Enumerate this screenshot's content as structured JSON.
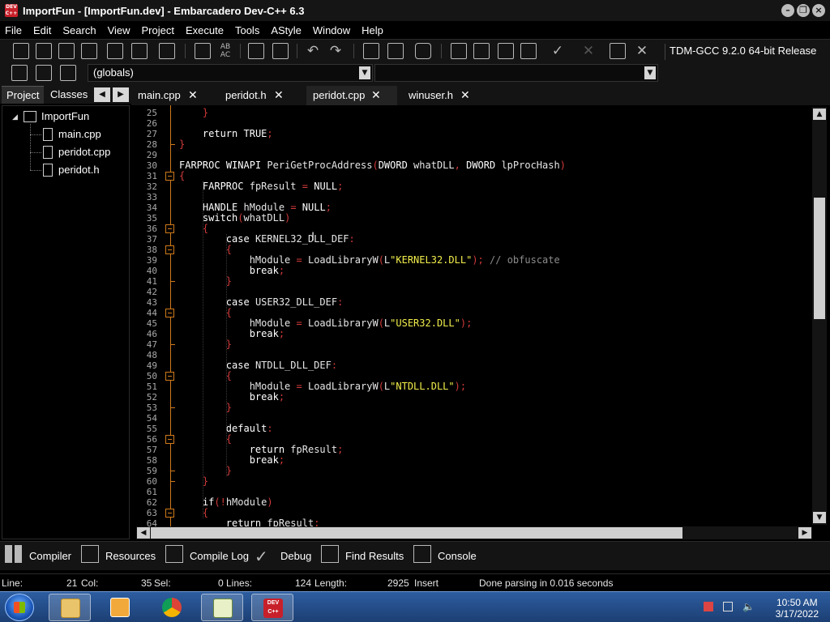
{
  "window": {
    "title": "ImportFun - [ImportFun.dev] - Embarcadero Dev-C++ 6.3",
    "logo_text": "DEV C++"
  },
  "menu": [
    "File",
    "Edit",
    "Search",
    "View",
    "Project",
    "Execute",
    "Tools",
    "AStyle",
    "Window",
    "Help"
  ],
  "toolbar": {
    "compiler": "TDM-GCC 9.2.0 64-bit Release",
    "scope_combo": "(globals)",
    "member_combo": ""
  },
  "left_panel": {
    "tabs": [
      "Project",
      "Classes"
    ],
    "tree": {
      "project": "ImportFun",
      "files": [
        "main.cpp",
        "peridot.cpp",
        "peridot.h"
      ]
    }
  },
  "editor_tabs": [
    {
      "label": "main.cpp",
      "close": "✕"
    },
    {
      "label": "peridot.h",
      "close": "✕"
    },
    {
      "label": "peridot.cpp",
      "close": "✕"
    },
    {
      "label": "winuser.h",
      "close": "✕"
    }
  ],
  "editor": {
    "line_numbers": [
      "25",
      "26",
      "27",
      "28",
      "29",
      "30",
      "31",
      "32",
      "33",
      "34",
      "35",
      "36",
      "37",
      "38",
      "39",
      "40",
      "41",
      "42",
      "43",
      "44",
      "45",
      "46",
      "47",
      "48",
      "49",
      "50",
      "51",
      "52",
      "53",
      "54",
      "55",
      "56",
      "57",
      "58",
      "59",
      "60",
      "61",
      "62",
      "63",
      "64"
    ],
    "lines": [
      "    }",
      "",
      "    return TRUE;",
      "}",
      "",
      "FARPROC WINAPI PeriGetProcAddress(DWORD whatDLL, DWORD lpProcHash)",
      "{",
      "    FARPROC fpResult = NULL;",
      "",
      "    HANDLE hModule = NULL;",
      "    switch(whatDLL)",
      "    {",
      "        case KERNEL32_DLL_DEF:",
      "        {",
      "            hModule = LoadLibraryW(L\"KERNEL32.DLL\"); // obfuscate",
      "            break;",
      "        }",
      "",
      "        case USER32_DLL_DEF:",
      "        {",
      "            hModule = LoadLibraryW(L\"USER32.DLL\");",
      "            break;",
      "        }",
      "",
      "        case NTDLL_DLL_DEF:",
      "        {",
      "            hModule = LoadLibraryW(L\"NTDLL.DLL\");",
      "            break;",
      "        }",
      "",
      "        default:",
      "        {",
      "            return fpResult;",
      "            break;",
      "        }",
      "    }",
      "",
      "    if(!hModule)",
      "    {",
      "        return fpResult;"
    ]
  },
  "bottom_tabs": [
    "Compiler",
    "Resources",
    "Compile Log",
    "Debug",
    "Find Results",
    "Console"
  ],
  "status": {
    "line_label": "Line:",
    "line": "21",
    "col_label": "Col:",
    "col": "35",
    "sel_label": "Sel:",
    "sel": "0",
    "lines_label": "Lines:",
    "lines": "124",
    "length_label": "Length:",
    "length": "2925",
    "mode": "Insert",
    "message": "Done parsing in 0.016 seconds"
  },
  "taskbar": {
    "time": "10:50 AM",
    "date": "3/17/2022",
    "dev_label": "DEV C++"
  },
  "colors": {
    "keyword": "#ffffff",
    "symbol": "#d33a3a",
    "string": "#f2ee4a",
    "comment": "#8c8c8c",
    "fold": "#d07a1a"
  }
}
